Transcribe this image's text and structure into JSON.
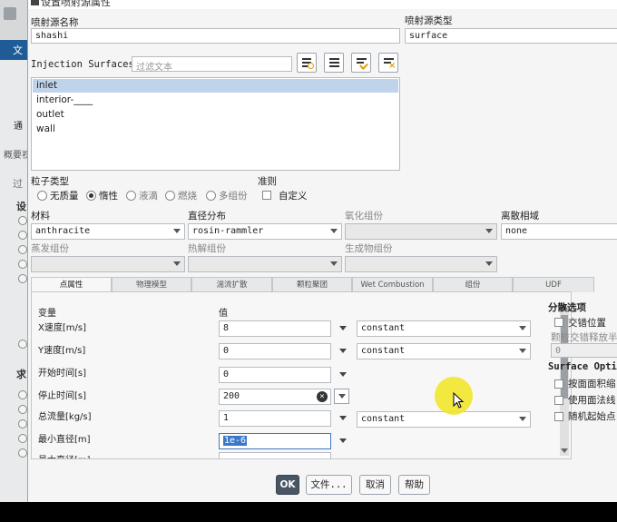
{
  "background_app": {
    "tab_label": "文",
    "left_label": "通",
    "outline_label": "概要视",
    "rows": [
      "过",
      "设",
      "求"
    ]
  },
  "dialog": {
    "title": "设置喷射源属性",
    "source_name_label": "喷射源名称",
    "source_name_value": "shashi",
    "source_type_label": "喷射源类型",
    "source_type_value": "surface",
    "injection_surfaces_label": "Injection Surfaces",
    "filter_placeholder": "过滤文本",
    "surfaces": [
      "inlet",
      "interior-____",
      "outlet",
      "wall"
    ],
    "selected_surface": "inlet",
    "particle_type_label": "粒子类型",
    "particle_types": [
      "无质量",
      "惰性",
      "液滴",
      "燃烧",
      "多组份"
    ],
    "selected_particle_type": "惰性",
    "criteria_label": "准则",
    "custom_label": "自定义",
    "material_label": "材料",
    "material_value": "anthracite",
    "diameter_label": "直径分布",
    "diameter_value": "rosin-rammler",
    "oxidizing_label": "氧化组份",
    "discrete_phase_label": "离散相域",
    "discrete_phase_value": "none",
    "evaporating_label": "蒸发组份",
    "devolatilizing_label": "热解组份",
    "product_label": "生成物组份",
    "tabs": [
      "点属性",
      "物理模型",
      "湍流扩散",
      "颗粒聚团",
      "Wet Combustion",
      "组份",
      "UDF"
    ],
    "active_tab": "点属性",
    "table_headers": {
      "variable": "变量",
      "value": "值"
    },
    "properties": [
      {
        "label": "X速度[m/s]",
        "value": "8",
        "method": "constant"
      },
      {
        "label": "Y速度[m/s]",
        "value": "0",
        "method": "constant"
      },
      {
        "label": "开始时间[s]",
        "value": "0",
        "method": ""
      },
      {
        "label": "停止时间[s]",
        "value": "200",
        "method": ""
      },
      {
        "label": "总流量[kg/s]",
        "value": "1",
        "method": "constant"
      },
      {
        "label": "最小直径[m]",
        "value": "1e-6",
        "method": ""
      },
      {
        "label": "最大直径[m]",
        "value": "",
        "method": ""
      }
    ],
    "scatter_title": "分散选项",
    "stagger_label": "交错位置",
    "stagger_sub_label": "颗粒交错释放半",
    "stagger_value": "0",
    "surface_options_title": "Surface Opti",
    "surface_options": [
      "按面面积缩",
      "使用面法线",
      "随机起始点"
    ],
    "buttons": {
      "ok": "OK",
      "file": "文件...",
      "cancel": "取消",
      "help": "帮助"
    }
  },
  "colors": {
    "selection": "#bfd3ea",
    "ok_button": "#4a5563",
    "cursor_highlight": "#f2e62a",
    "bg_tab": "#1f5b96"
  }
}
